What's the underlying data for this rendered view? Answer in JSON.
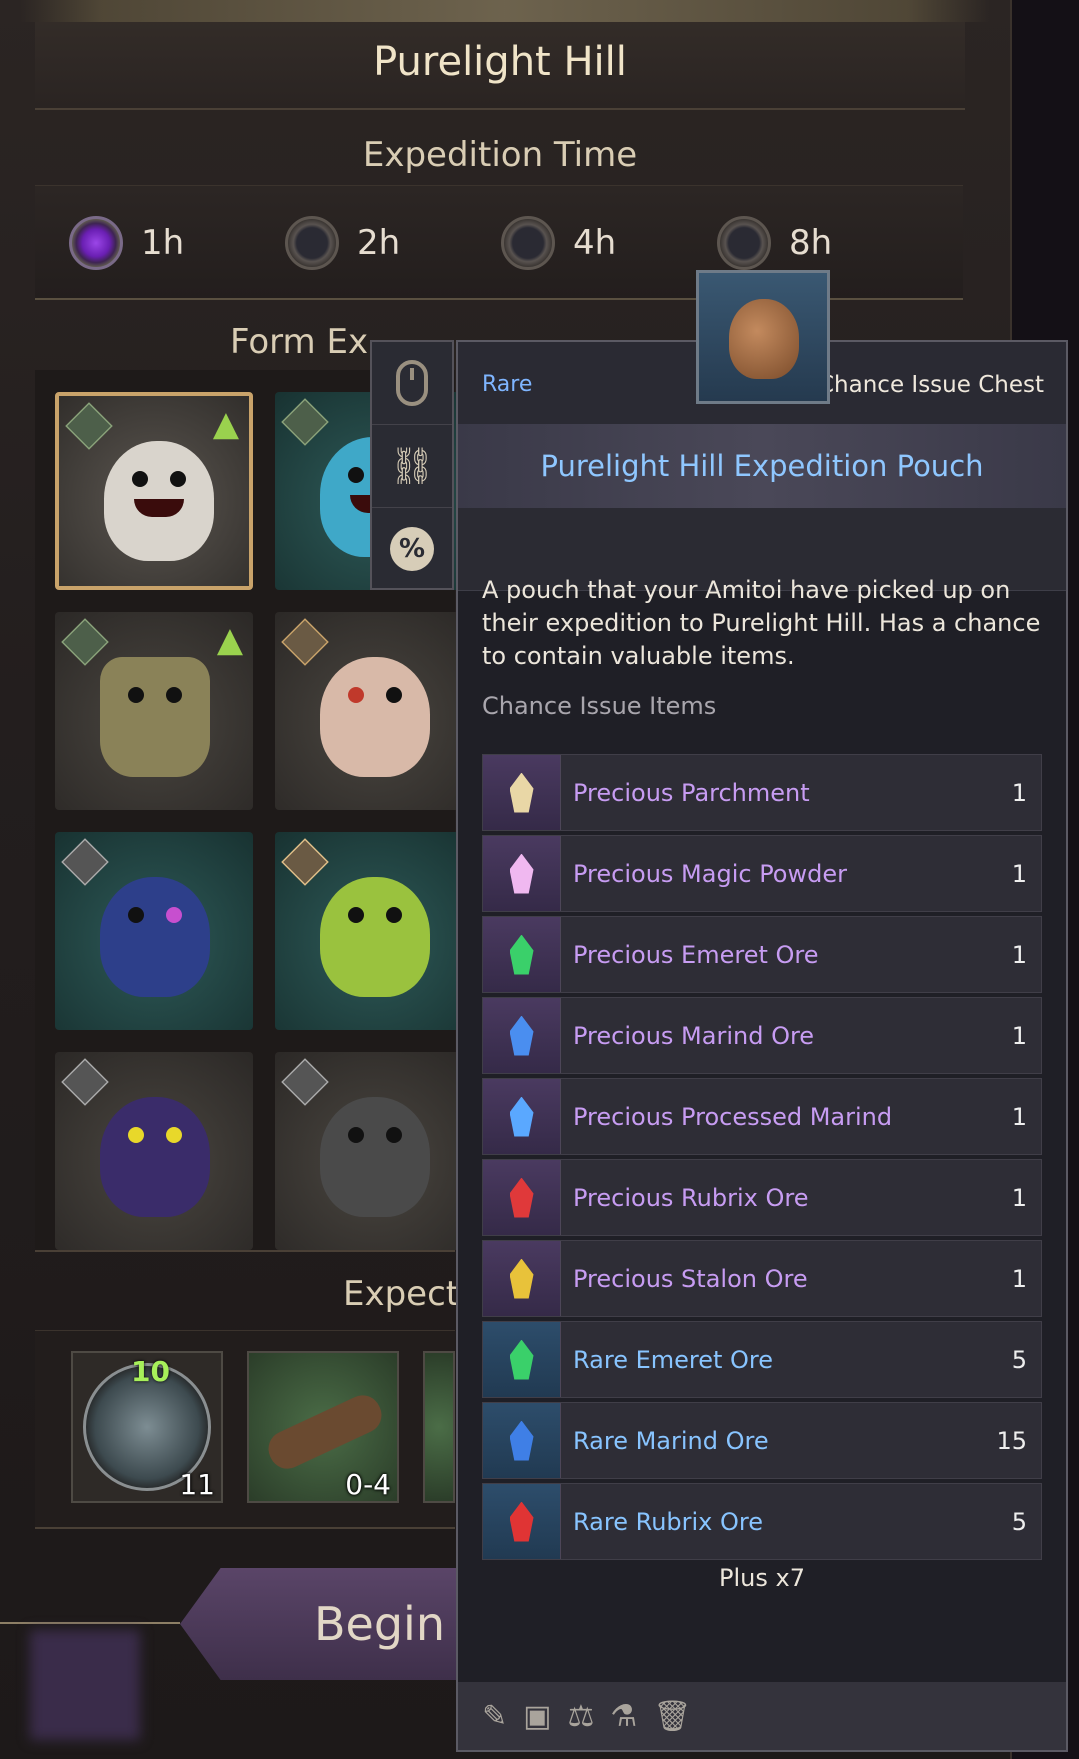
{
  "header": {
    "title": "Purelight Hill"
  },
  "expedition_time": {
    "label": "Expedition Time",
    "options": [
      {
        "label": "1h",
        "selected": true
      },
      {
        "label": "2h",
        "selected": false
      },
      {
        "label": "4h",
        "selected": false
      },
      {
        "label": "8h",
        "selected": false
      }
    ]
  },
  "team": {
    "label_visible": "Form Ex"
  },
  "expected": {
    "label_visible": "Expect",
    "rewards": [
      {
        "icon": "skull-emblem-icon",
        "level": "10",
        "qty": "11"
      },
      {
        "icon": "log-icon",
        "qty": "0-4"
      }
    ]
  },
  "begin": {
    "label": "Begin"
  },
  "tooltip": {
    "rarity": "Rare",
    "item_type": "Chance Issue Chest",
    "name": "Purelight Hill Expedition Pouch",
    "description_lines": [
      "A pouch that your Amitoi have picked up on",
      "their expedition to Purelight Hill. Has a chance",
      "to contain valuable items."
    ],
    "items_heading": "Chance Issue Items",
    "items": [
      {
        "name": "Precious Parchment",
        "count": "1",
        "tier": "precious",
        "icon": "parchment-icon",
        "color": "#e9d7a6"
      },
      {
        "name": "Precious Magic Powder",
        "count": "1",
        "tier": "precious",
        "icon": "magic-powder-icon",
        "color": "#f0b8f0"
      },
      {
        "name": "Precious Emeret Ore",
        "count": "1",
        "tier": "precious",
        "icon": "green-gem-icon",
        "color": "#3ad06a"
      },
      {
        "name": "Precious Marind Ore",
        "count": "1",
        "tier": "precious",
        "icon": "blue-gem-icon",
        "color": "#4a8ef0"
      },
      {
        "name": "Precious Processed Marind",
        "count": "1",
        "tier": "precious",
        "icon": "processed-marind-icon",
        "color": "#5aa8ff"
      },
      {
        "name": "Precious Rubrix Ore",
        "count": "1",
        "tier": "precious",
        "icon": "red-gem-icon",
        "color": "#e0393a"
      },
      {
        "name": "Precious Stalon Ore",
        "count": "1",
        "tier": "precious",
        "icon": "yellow-gem-icon",
        "color": "#e8c23a"
      },
      {
        "name": "Rare Emeret Ore",
        "count": "5",
        "tier": "rare",
        "icon": "green-gem-icon",
        "color": "#3ad06a"
      },
      {
        "name": "Rare Marind Ore",
        "count": "15",
        "tier": "rare",
        "icon": "blue-gem-icon",
        "color": "#3f7fe6"
      },
      {
        "name": "Rare Rubrix Ore",
        "count": "5",
        "tier": "rare",
        "icon": "red-gem-icon",
        "color": "#e03434"
      }
    ],
    "plus_more": "Plus x7",
    "footer_icons": [
      "book-quill-icon",
      "crate-icon",
      "scales-icon",
      "flask-icon",
      "trash-icon"
    ]
  }
}
